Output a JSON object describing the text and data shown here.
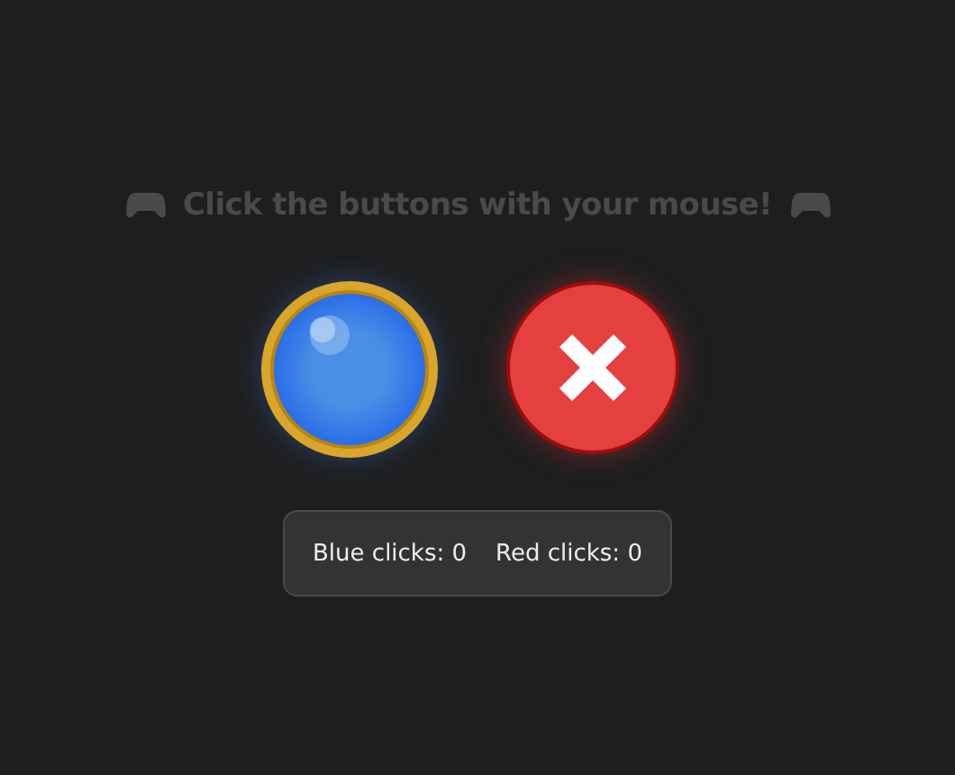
{
  "heading": "Click the buttons with your mouse!",
  "buttons": [
    {
      "kind": "blue"
    },
    {
      "kind": "red"
    }
  ],
  "stats": [
    "Blue clicks: 0",
    "Red clicks: 0"
  ]
}
